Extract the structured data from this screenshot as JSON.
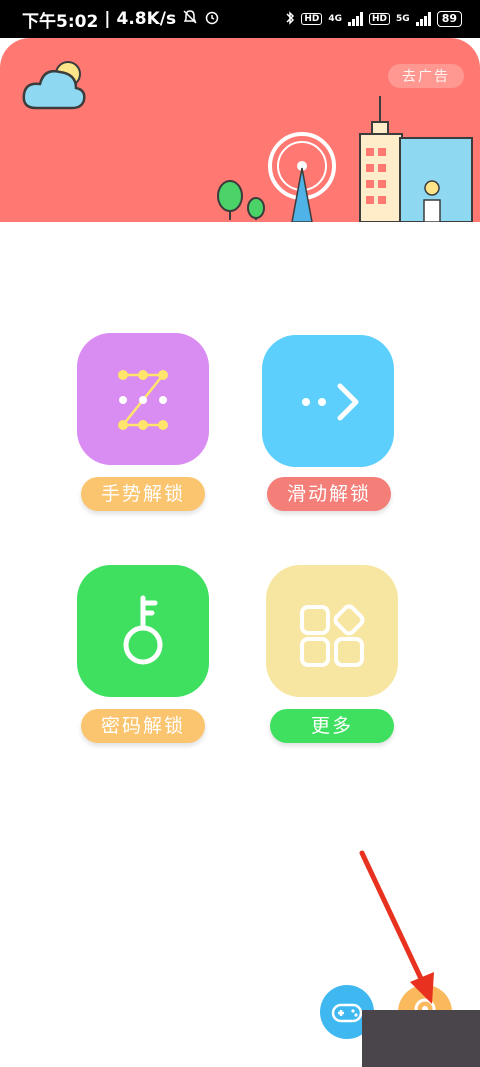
{
  "status_bar": {
    "time": "下午5:02",
    "network_speed": "4.8K/s",
    "battery": "89",
    "net1": "4G",
    "net2": "5G",
    "hd": "HD"
  },
  "header": {
    "ad_button": "去广告"
  },
  "menu": {
    "gesture_unlock": "手势解锁",
    "slide_unlock": "滑动解锁",
    "password_unlock": "密码解锁",
    "more": "更多"
  },
  "colors": {
    "header_bg": "#ff7872",
    "gesture_tile": "#d98cf2",
    "gesture_pill": "#fbc46e",
    "slide_tile": "#5ccffd",
    "slide_pill": "#f47e78",
    "password_tile": "#3fe060",
    "password_pill": "#fbc46e",
    "more_tile": "#f7e6a2",
    "more_pill": "#3fe060",
    "game_fab": "#3fb8f2",
    "settings_fab": "#fbb95e",
    "annotation_arrow": "#e8321f"
  }
}
